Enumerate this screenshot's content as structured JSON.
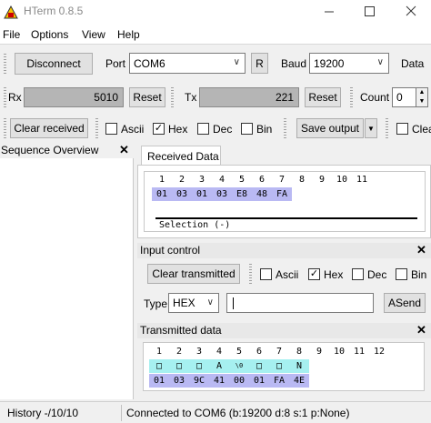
{
  "window": {
    "title": "HTerm 0.8.5"
  },
  "menu": [
    "File",
    "Options",
    "View",
    "Help"
  ],
  "connection": {
    "disconnect_label": "Disconnect",
    "port_label": "Port",
    "port_value": "COM6",
    "r_label": "R",
    "baud_label": "Baud",
    "baud_value": "19200",
    "data_label": "Data"
  },
  "counters": {
    "rx_label": "Rx",
    "rx_value": "5010",
    "rx_reset": "Reset",
    "tx_label": "Tx",
    "tx_value": "221",
    "tx_reset": "Reset",
    "count_label": "Count",
    "count_value": "0"
  },
  "display_opts": {
    "clear_received": "Clear received",
    "ascii": "Ascii",
    "hex": "Hex",
    "dec": "Dec",
    "bin": "Bin",
    "save_output": "Save output",
    "clear_partial": "Clea"
  },
  "sequence": {
    "title": "Sequence Overview"
  },
  "received": {
    "tab": "Received Data",
    "indices": [
      "1",
      "2",
      "3",
      "4",
      "5",
      "6",
      "7",
      "8",
      "9",
      "10",
      "11"
    ],
    "bytes": [
      "01",
      "03",
      "01",
      "03",
      "E8",
      "48",
      "FA"
    ],
    "selection": "Selection (-)"
  },
  "input_control": {
    "title": "Input control",
    "clear_transmitted": "Clear transmitted",
    "ascii": "Ascii",
    "hex": "Hex",
    "dec": "Dec",
    "bin": "Bin",
    "type_label": "Type",
    "type_value": "HEX",
    "input_value": "",
    "asend_label": "ASend"
  },
  "transmitted": {
    "title": "Transmitted data",
    "indices": [
      "1",
      "2",
      "3",
      "4",
      "5",
      "6",
      "7",
      "8",
      "9",
      "10",
      "11",
      "12"
    ],
    "ascii": [
      "□",
      "□",
      "□",
      "A",
      "\\0",
      "□",
      "□",
      "N"
    ],
    "bytes": [
      "01",
      "03",
      "9C",
      "41",
      "00",
      "01",
      "FA",
      "4E"
    ]
  },
  "status": {
    "history": "History -/10/10",
    "connection": "Connected to COM6 (b:19200 d:8 s:1 p:None)"
  }
}
